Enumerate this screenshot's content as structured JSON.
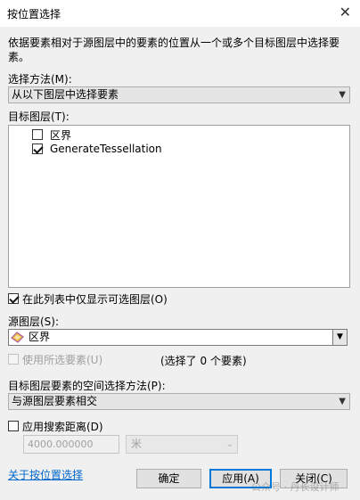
{
  "window": {
    "title": "按位置选择",
    "close_glyph": "✕"
  },
  "description": "依据要素相对于源图层中的要素的位置从一个或多个目标图层中选择要素。",
  "selection_method": {
    "label": "选择方法(M):",
    "value": "从以下图层中选择要素"
  },
  "target_layers": {
    "label": "目标图层(T):",
    "items": [
      {
        "name": "区界",
        "checked": false
      },
      {
        "name": "GenerateTessellation",
        "checked": true
      }
    ]
  },
  "only_selectable": {
    "label": "在此列表中仅显示可选图层(O)",
    "checked": true
  },
  "source_layer": {
    "label": "源图层(S):",
    "value": "区界",
    "icon": "polygon-layer-icon"
  },
  "use_selected": {
    "label": "使用所选要素(U)",
    "checked": false,
    "enabled": false
  },
  "selected_count": "(选择了 0 个要素)",
  "spatial_method": {
    "label": "目标图层要素的空间选择方法(P):",
    "value": "与源图层要素相交"
  },
  "search_distance": {
    "label": "应用搜索距离(D)",
    "checked": false,
    "value": "4000.000000",
    "unit": "米"
  },
  "help_link": "关于按位置选择",
  "buttons": {
    "ok": "确定",
    "apply": "应用(A)",
    "close": "关闭(C)"
  },
  "watermark": "公众号 · 丹长设计师"
}
